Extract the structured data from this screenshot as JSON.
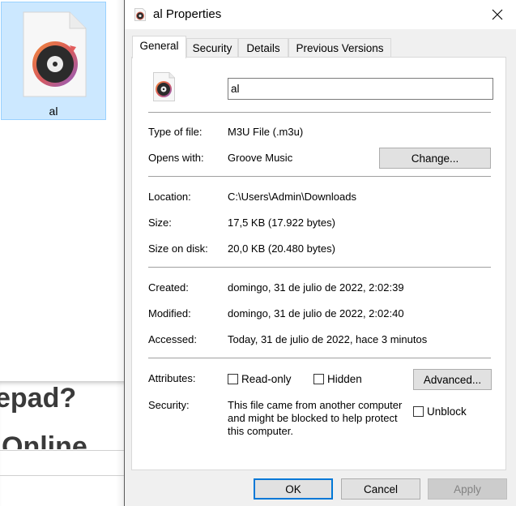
{
  "background": {
    "explorer": {
      "selected_file": {
        "name": "al",
        "icon": "groove-music-playlist-file-icon"
      }
    },
    "webpage": {
      "heading_fragment": "epad?",
      "subheading_fragment": "Online"
    }
  },
  "dialog": {
    "title": "al Properties",
    "title_icon": "groove-music-file-icon",
    "close_icon": "close-icon",
    "tabs": [
      {
        "label": "General",
        "active": true
      },
      {
        "label": "Security",
        "active": false
      },
      {
        "label": "Details",
        "active": false
      },
      {
        "label": "Previous Versions",
        "active": false
      }
    ],
    "general": {
      "file_icon": "groove-music-file-icon",
      "file_name": "al",
      "type_of_file": {
        "label": "Type of file:",
        "value": "M3U File (.m3u)"
      },
      "opens_with": {
        "label": "Opens with:",
        "value": "Groove Music",
        "button": "Change..."
      },
      "location": {
        "label": "Location:",
        "value": "C:\\Users\\Admin\\Downloads"
      },
      "size": {
        "label": "Size:",
        "value": "17,5 KB (17.922 bytes)"
      },
      "size_on_disk": {
        "label": "Size on disk:",
        "value": "20,0 KB (20.480 bytes)"
      },
      "created": {
        "label": "Created:",
        "value": "domingo, 31 de julio de 2022, 2:02:39"
      },
      "modified": {
        "label": "Modified:",
        "value": "domingo, 31 de julio de 2022, 2:02:40"
      },
      "accessed": {
        "label": "Accessed:",
        "value": "Today, 31 de julio de 2022, hace 3 minutos"
      },
      "attributes": {
        "label": "Attributes:",
        "read_only": {
          "label": "Read-only",
          "checked": false
        },
        "hidden": {
          "label": "Hidden",
          "checked": false
        },
        "advanced_button": "Advanced..."
      },
      "security": {
        "label": "Security:",
        "text": "This file came from another computer and might be blocked to help protect this computer.",
        "unblock": {
          "label": "Unblock",
          "checked": false
        }
      }
    },
    "buttons": {
      "ok": "OK",
      "cancel": "Cancel",
      "apply": "Apply",
      "apply_enabled": false
    },
    "colors": {
      "focus_border": "#0078d7",
      "selection_bg": "#cce8ff",
      "dialog_bg": "#f0f0f0"
    }
  }
}
